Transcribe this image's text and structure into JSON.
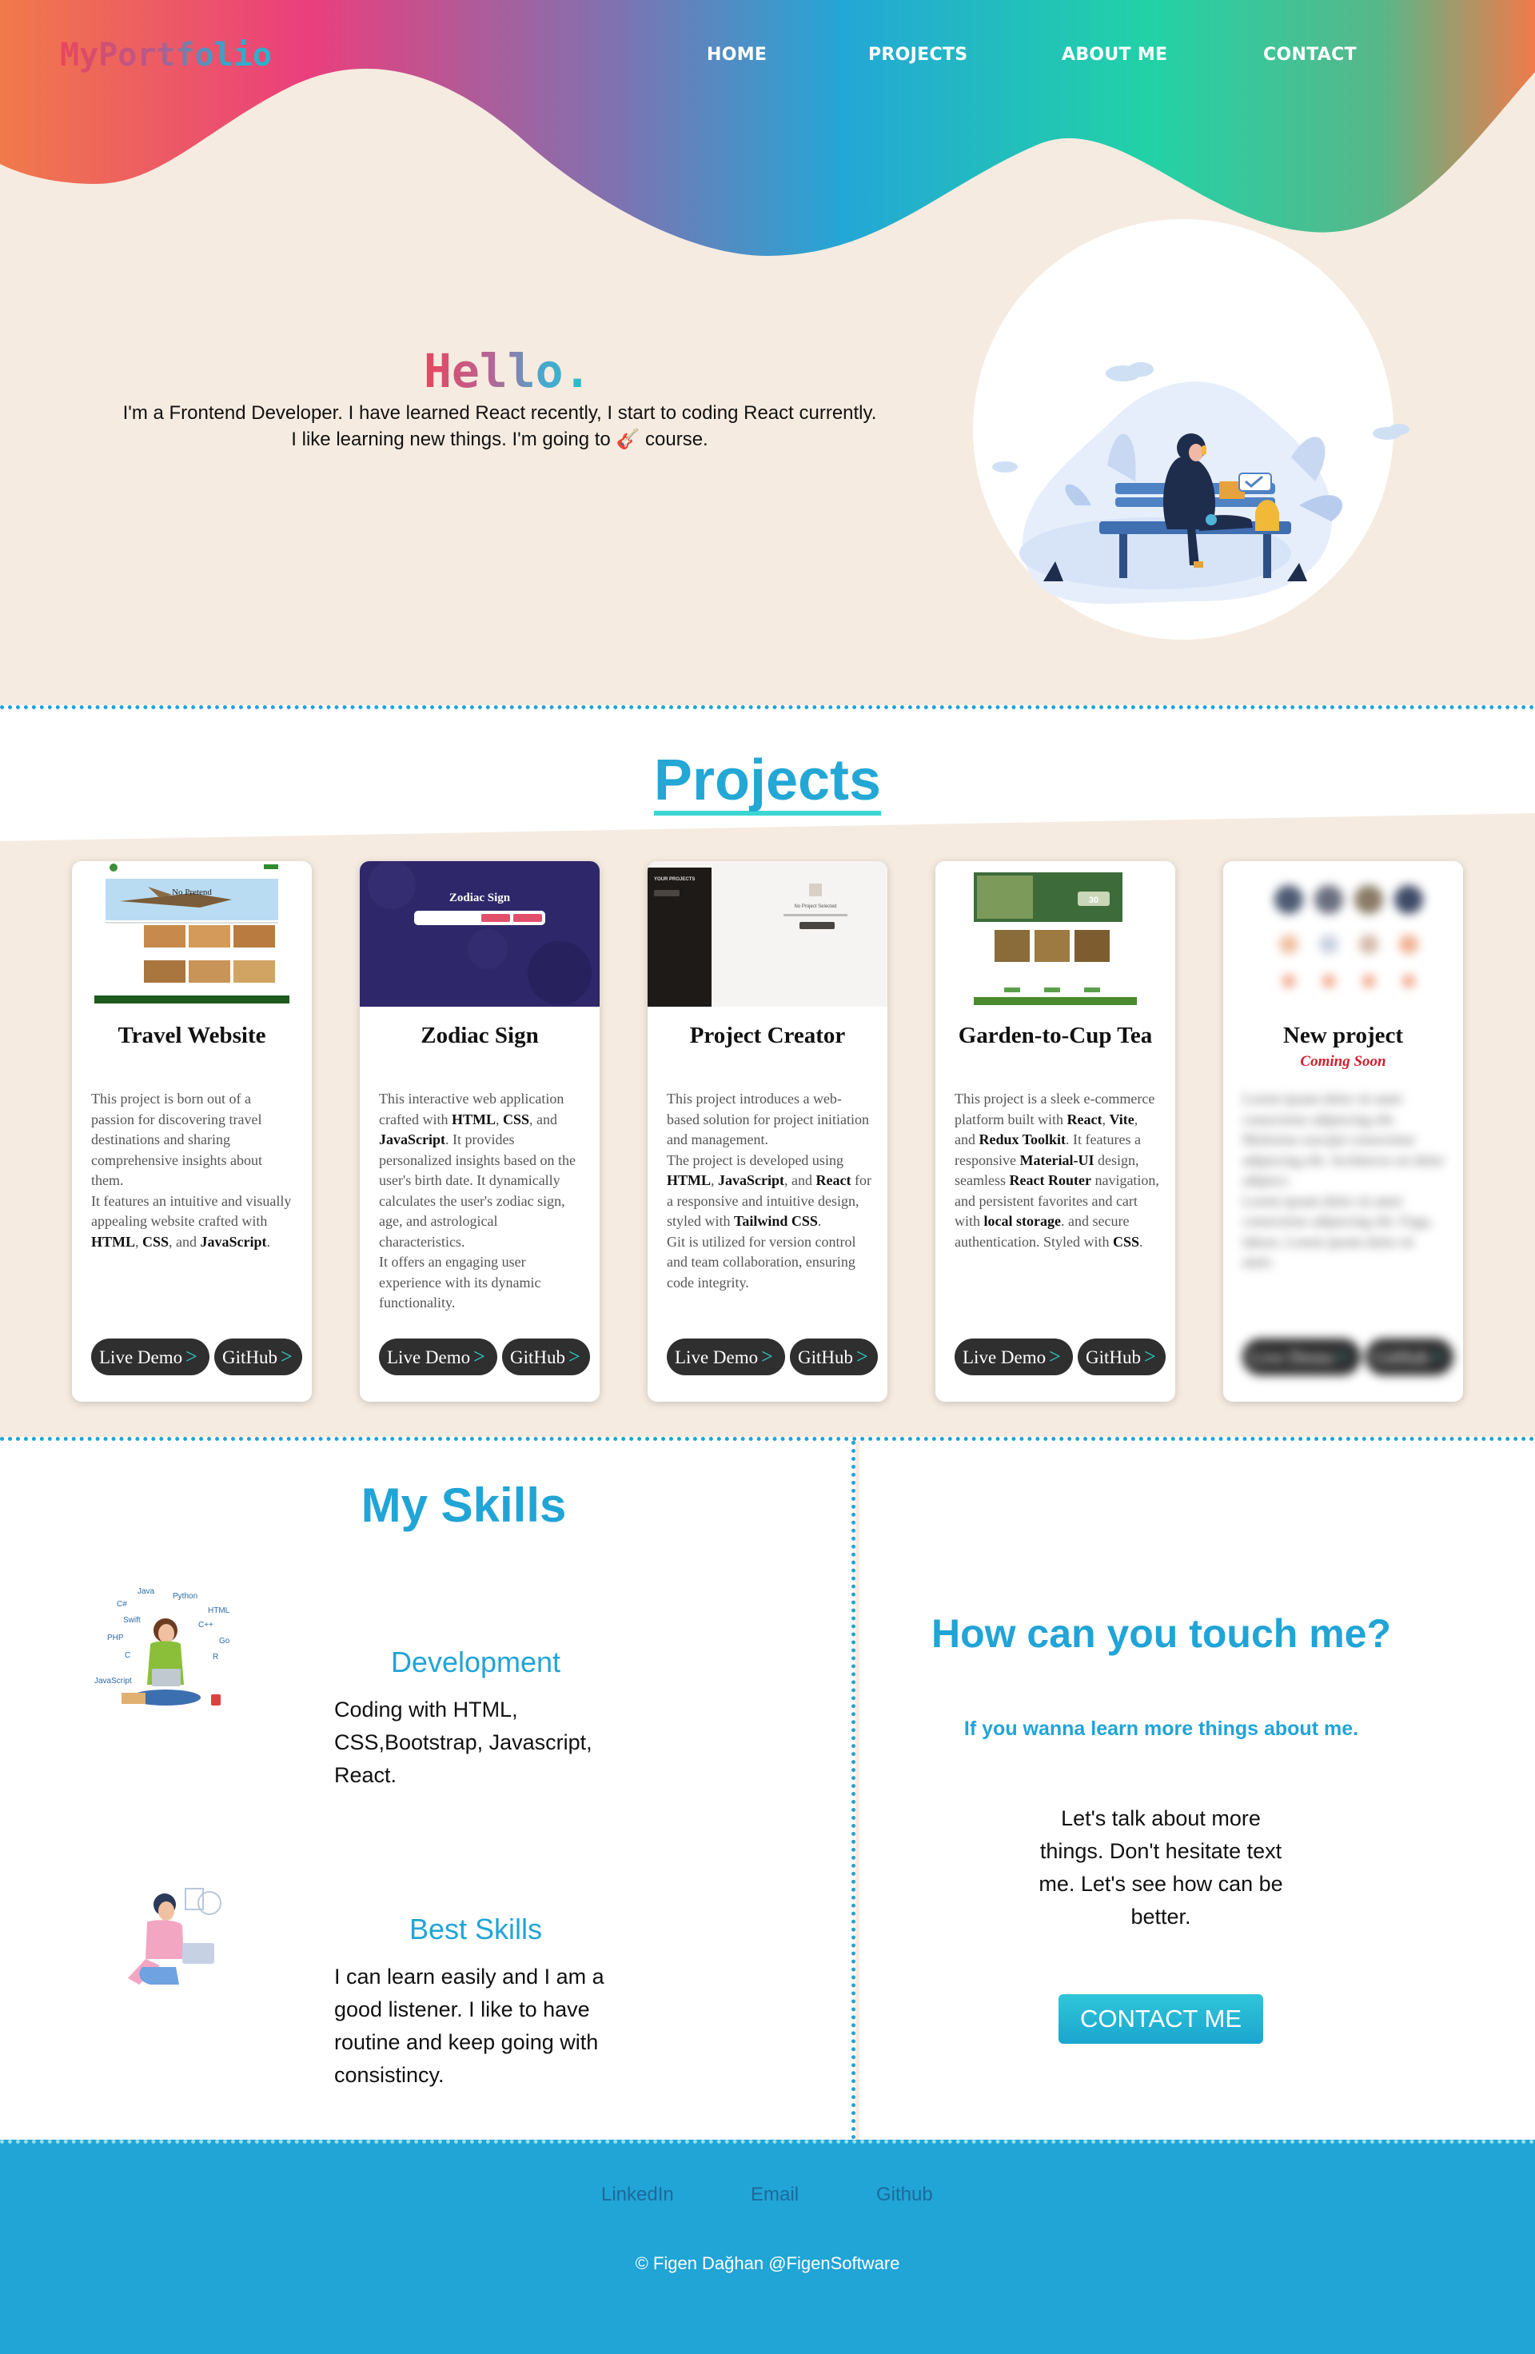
{
  "header": {
    "logo": "MyPortfolio",
    "nav": [
      "HOME",
      "PROJECTS",
      "ABOUT ME",
      "CONTACT"
    ]
  },
  "hero": {
    "greeting": "Hello.",
    "intro_line1": "I'm a Frontend Developer. I have learned React recently, I start to coding React currently.",
    "intro_line2_before": "I like learning new things. I'm going to",
    "intro_emoji": "🎸",
    "intro_line2_after": "course."
  },
  "projects": {
    "title": "Projects",
    "cards": [
      {
        "title": "Travel Website",
        "subtitle": "",
        "thumb": {
          "banner": "No Pretend",
          "tagline": "Travel Away"
        },
        "desc": [
          {
            "t": "This project is born out of a passion for discovering travel destinations and sharing comprehensive insights about them.",
            "b": false,
            "br": true
          },
          {
            "t": "It features an intuitive and visually appealing website crafted with ",
            "b": false
          },
          {
            "t": "HTML",
            "b": true
          },
          {
            "t": ", ",
            "b": false
          },
          {
            "t": "CSS",
            "b": true
          },
          {
            "t": ", and ",
            "b": false
          },
          {
            "t": "JavaScript",
            "b": true
          },
          {
            "t": ".",
            "b": false
          }
        ],
        "buttons": [
          "Live Demo",
          "GitHub"
        ]
      },
      {
        "title": "Zodiac Sign",
        "subtitle": "",
        "thumb": {
          "banner": "Zodiac Sign"
        },
        "desc": [
          {
            "t": "This interactive web application crafted with ",
            "b": false
          },
          {
            "t": "HTML",
            "b": true
          },
          {
            "t": ", ",
            "b": false
          },
          {
            "t": "CSS",
            "b": true
          },
          {
            "t": ", and ",
            "b": false
          },
          {
            "t": "JavaScript",
            "b": true
          },
          {
            "t": ". It provides personalized insights based on the user's birth date. It dynamically calculates the user's zodiac sign, age, and astrological characteristics.",
            "b": false,
            "br": true
          },
          {
            "t": "It offers an engaging user experience with its dynamic functionality.",
            "b": false
          }
        ],
        "buttons": [
          "Live Demo",
          "GitHub"
        ]
      },
      {
        "title": "Project Creator",
        "subtitle": "",
        "thumb": {
          "sidebar": "YOUR PROJECTS",
          "empty": "No Project Selected"
        },
        "desc": [
          {
            "t": "This project introduces a web-based solution for project initiation and management.",
            "b": false,
            "br": true
          },
          {
            "t": "The project is developed using ",
            "b": false
          },
          {
            "t": "HTML",
            "b": true
          },
          {
            "t": ", ",
            "b": false
          },
          {
            "t": "JavaScript",
            "b": true
          },
          {
            "t": ", and ",
            "b": false
          },
          {
            "t": "React",
            "b": true
          },
          {
            "t": " for a responsive and intuitive design, styled with ",
            "b": false
          },
          {
            "t": "Tailwind CSS",
            "b": true
          },
          {
            "t": ".",
            "b": false,
            "br": true
          },
          {
            "t": "Git is utilized for version control and team collaboration, ensuring code integrity.",
            "b": false
          }
        ],
        "buttons": [
          "Live Demo",
          "GitHub"
        ]
      },
      {
        "title": "Garden-to-Cup Tea",
        "subtitle": "",
        "thumb": {
          "badge": "30"
        },
        "desc": [
          {
            "t": "This project is a sleek e-commerce platform built with ",
            "b": false
          },
          {
            "t": "React",
            "b": true
          },
          {
            "t": ", ",
            "b": false
          },
          {
            "t": "Vite",
            "b": true
          },
          {
            "t": ", and ",
            "b": false
          },
          {
            "t": "Redux Toolkit",
            "b": true
          },
          {
            "t": ". It features a responsive ",
            "b": false
          },
          {
            "t": "Material-UI",
            "b": true
          },
          {
            "t": " design, seamless ",
            "b": false
          },
          {
            "t": "React Router",
            "b": true
          },
          {
            "t": " navigation, and persistent favorites and cart with ",
            "b": false
          },
          {
            "t": "local storage",
            "b": true
          },
          {
            "t": ". and secure authentication. Styled with ",
            "b": false
          },
          {
            "t": "CSS",
            "b": true
          },
          {
            "t": ".",
            "b": false
          }
        ],
        "buttons": [
          "Live Demo",
          "GitHub"
        ]
      },
      {
        "title": "New project",
        "subtitle": "Coming Soon",
        "thumb": {},
        "desc": [
          {
            "t": "Lorem ipsum dolor sit amet consectetur adipiscing elit. Molestias suscipit consectetur adipiscing elit. Architecto est dolor adipisci.",
            "b": false,
            "br": true
          },
          {
            "t": "Lorem ipsum dolor sit amet consectetur adipiscing elit. Fuga, labore, Lorem ipsum dolor sit amet.",
            "b": false
          }
        ],
        "buttons": [
          "Live Demo",
          "GitHub"
        ]
      }
    ]
  },
  "skills": {
    "title": "My Skills",
    "items": [
      {
        "heading": "Development",
        "text": "Coding with HTML, CSS,Bootstrap, Javascript, React."
      },
      {
        "heading": "Best Skills",
        "text": "I can learn easily and I am a good listener. I like to have routine and keep going with consistincy."
      }
    ],
    "tech_labels": [
      "Java",
      "Python",
      "C#",
      "HTML",
      "Swift",
      "C++",
      "PHP",
      "Go",
      "C",
      "R",
      "JavaScript"
    ]
  },
  "contact": {
    "title": "How can you touch me?",
    "subtitle": "If you wanna learn more things about me.",
    "text": "Let's talk about more things. Don't hesitate text me. Let's see how can be better.",
    "button": "CONTACT ME"
  },
  "footer": {
    "links": [
      "LinkedIn",
      "Email",
      "Github"
    ],
    "copyright": "© Figen Dağhan @FigenSoftware"
  },
  "colors": {
    "accent": "#21a4d6",
    "cream": "#f6ebe0",
    "button_dark": "#2f2f2f",
    "arrow": "#2fd1c4",
    "coming_soon": "#d21f2e"
  }
}
